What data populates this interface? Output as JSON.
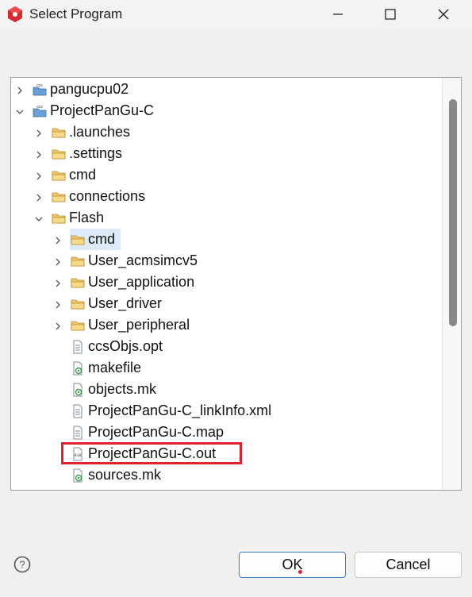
{
  "window": {
    "title": "Select Program",
    "controls": {
      "minimize": "minimize-icon",
      "maximize": "maximize-icon",
      "close": "close-icon"
    }
  },
  "tree": {
    "items": [
      {
        "label": "pangucpu02",
        "icon": "ccs-project-icon",
        "expander": "collapsed"
      },
      {
        "label": "ProjectPanGu-C",
        "icon": "ccs-project-icon",
        "expander": "expanded"
      },
      {
        "label": ".launches",
        "icon": "folder-icon",
        "expander": "collapsed"
      },
      {
        "label": ".settings",
        "icon": "folder-icon",
        "expander": "collapsed"
      },
      {
        "label": "cmd",
        "icon": "folder-icon",
        "expander": "collapsed"
      },
      {
        "label": "connections",
        "icon": "folder-icon",
        "expander": "collapsed"
      },
      {
        "label": "Flash",
        "icon": "folder-icon",
        "expander": "expanded"
      },
      {
        "label": "cmd",
        "icon": "folder-icon",
        "expander": "collapsed",
        "selected": true
      },
      {
        "label": "User_acmsimcv5",
        "icon": "folder-icon",
        "expander": "collapsed"
      },
      {
        "label": "User_application",
        "icon": "folder-icon",
        "expander": "collapsed"
      },
      {
        "label": "User_driver",
        "icon": "folder-icon",
        "expander": "collapsed"
      },
      {
        "label": "User_peripheral",
        "icon": "folder-icon",
        "expander": "collapsed"
      },
      {
        "label": "ccsObjs.opt",
        "icon": "text-file-icon"
      },
      {
        "label": "makefile",
        "icon": "makefile-icon"
      },
      {
        "label": "objects.mk",
        "icon": "makefile-icon"
      },
      {
        "label": "ProjectPanGu-C_linkInfo.xml",
        "icon": "text-file-icon"
      },
      {
        "label": "ProjectPanGu-C.map",
        "icon": "text-file-icon"
      },
      {
        "label": "ProjectPanGu-C.out",
        "icon": "binary-file-icon",
        "highlighted": true
      },
      {
        "label": "sources.mk",
        "icon": "makefile-icon"
      }
    ]
  },
  "buttons": {
    "ok": "OK",
    "cancel": "Cancel",
    "help": "help-icon"
  },
  "colors": {
    "highlight_border": "#e0222e",
    "selection_bg": "#dcebf7",
    "folder_fill": "#f2c766",
    "ok_border": "#3b7dc4"
  }
}
